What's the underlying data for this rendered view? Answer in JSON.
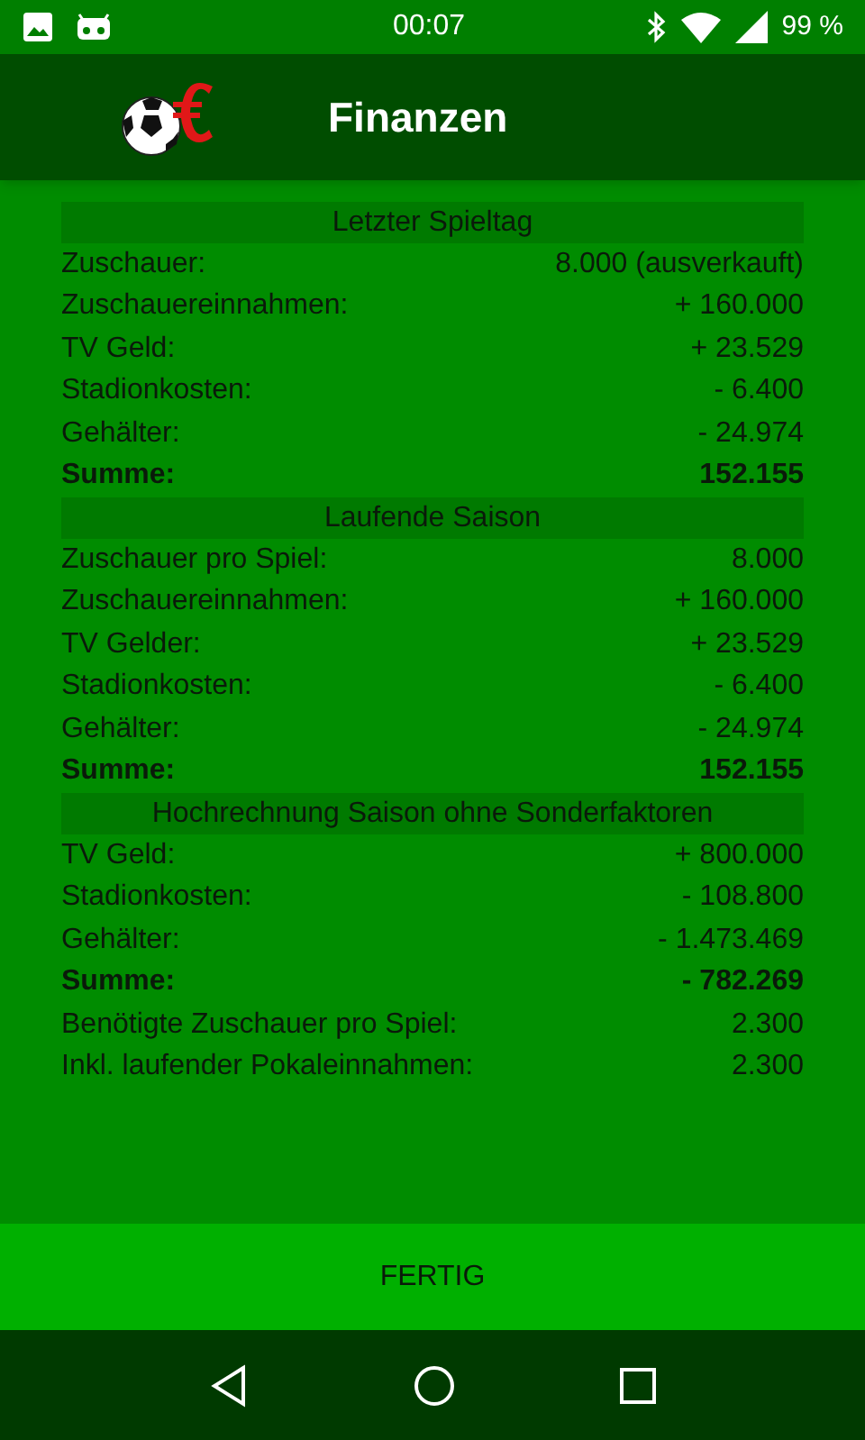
{
  "status_bar": {
    "time": "00:07",
    "battery": "99 %"
  },
  "app_bar": {
    "title": "Finanzen"
  },
  "sections": [
    {
      "title": "Letzter Spieltag",
      "rows": [
        {
          "kind": "item",
          "label": "Zuschauer:",
          "value": "8.000 (ausverkauft)"
        },
        {
          "kind": "item",
          "label": "Zuschauereinnahmen:",
          "value": "+ 160.000"
        },
        {
          "kind": "item",
          "label": "TV Geld:",
          "value": "+ 23.529"
        },
        {
          "kind": "item",
          "label": "Stadionkosten:",
          "value": "- 6.400"
        },
        {
          "kind": "item",
          "label": "Gehälter:",
          "value": "- 24.974"
        },
        {
          "kind": "total",
          "label": "Summe:",
          "value": "152.155"
        }
      ]
    },
    {
      "title": "Laufende Saison",
      "rows": [
        {
          "kind": "item",
          "label": "Zuschauer pro Spiel:",
          "value": "8.000"
        },
        {
          "kind": "item",
          "label": "Zuschauereinnahmen:",
          "value": "+ 160.000"
        },
        {
          "kind": "item",
          "label": "TV Gelder:",
          "value": "+ 23.529"
        },
        {
          "kind": "item",
          "label": "Stadionkosten:",
          "value": "- 6.400"
        },
        {
          "kind": "item",
          "label": "Gehälter:",
          "value": "- 24.974"
        },
        {
          "kind": "total",
          "label": "Summe:",
          "value": "152.155"
        }
      ]
    },
    {
      "title": "Hochrechnung Saison ohne Sonderfaktoren",
      "rows": [
        {
          "kind": "item",
          "label": "TV Geld:",
          "value": "+ 800.000"
        },
        {
          "kind": "item",
          "label": "Stadionkosten:",
          "value": "- 108.800"
        },
        {
          "kind": "item",
          "label": "Gehälter:",
          "value": "- 1.473.469"
        },
        {
          "kind": "total",
          "label": "Summe:",
          "value": "- 782.269"
        },
        {
          "kind": "item",
          "label": "Benötigte Zuschauer pro Spiel:",
          "value": "2.300"
        },
        {
          "kind": "item",
          "label": "Inkl. laufender Pokaleinnahmen:",
          "value": "2.300"
        }
      ]
    }
  ],
  "button": {
    "label": "FERTIG"
  }
}
